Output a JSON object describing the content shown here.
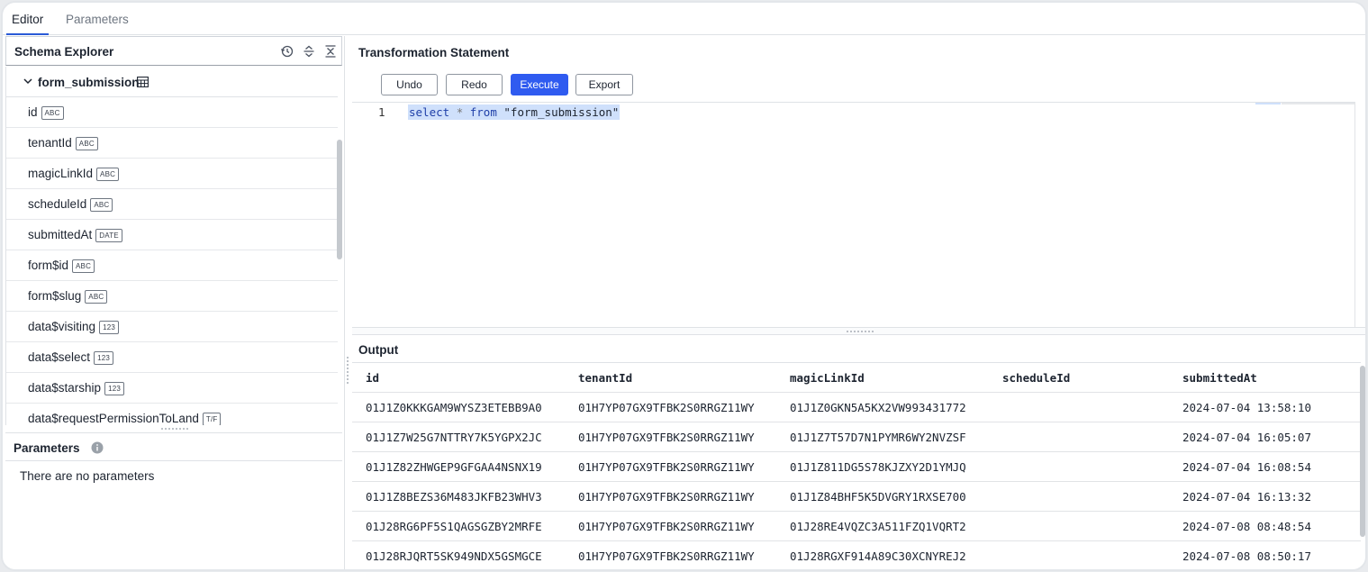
{
  "tabs": [
    {
      "label": "Editor",
      "active": true
    },
    {
      "label": "Parameters",
      "active": false
    }
  ],
  "schema_explorer": {
    "title": "Schema Explorer",
    "icons": [
      "history-icon",
      "expand-all-icon",
      "collapse-all-icon"
    ],
    "table": {
      "name": "form_submission",
      "icon": "table-icon"
    },
    "fields": [
      {
        "name": "id",
        "type": "ABC"
      },
      {
        "name": "tenantId",
        "type": "ABC"
      },
      {
        "name": "magicLinkId",
        "type": "ABC"
      },
      {
        "name": "scheduleId",
        "type": "ABC"
      },
      {
        "name": "submittedAt",
        "type": "DATE"
      },
      {
        "name": "form$id",
        "type": "ABC"
      },
      {
        "name": "form$slug",
        "type": "ABC"
      },
      {
        "name": "data$visiting",
        "type": "123"
      },
      {
        "name": "data$select",
        "type": "123"
      },
      {
        "name": "data$starship",
        "type": "123"
      },
      {
        "name": "data$requestPermissionToLand",
        "type": "T/F"
      }
    ]
  },
  "parameters": {
    "title": "Parameters",
    "empty_text": "There are no parameters"
  },
  "statement": {
    "title": "Transformation Statement",
    "buttons": {
      "undo": "Undo",
      "redo": "Redo",
      "execute": "Execute",
      "export": "Export"
    },
    "line_number": "1",
    "code": {
      "kw1": "select",
      "op": "*",
      "kw2": "from",
      "table": "\"form_submission\""
    }
  },
  "output": {
    "title": "Output",
    "columns": [
      "id",
      "tenantId",
      "magicLinkId",
      "scheduleId",
      "submittedAt"
    ],
    "rows": [
      [
        "01J1Z0KKKGAM9WYSZ3ETEBB9A0",
        "01H7YP07GX9TFBK2S0RRGZ11WY",
        "01J1Z0GKN5A5KX2VW993431772",
        "",
        "2024-07-04 13:58:10"
      ],
      [
        "01J1Z7W25G7NTTRY7K5YGPX2JC",
        "01H7YP07GX9TFBK2S0RRGZ11WY",
        "01J1Z7T57D7N1PYMR6WY2NVZSF",
        "",
        "2024-07-04 16:05:07"
      ],
      [
        "01J1Z82ZHWGEP9GFGAA4NSNX19",
        "01H7YP07GX9TFBK2S0RRGZ11WY",
        "01J1Z811DG5S78KJZXY2D1YMJQ",
        "",
        "2024-07-04 16:08:54"
      ],
      [
        "01J1Z8BEZS36M483JKFB23WHV3",
        "01H7YP07GX9TFBK2S0RRGZ11WY",
        "01J1Z84BHF5K5DVGRY1RXSE700",
        "",
        "2024-07-04 16:13:32"
      ],
      [
        "01J28RG6PF5S1QAGSGZBY2MRFE",
        "01H7YP07GX9TFBK2S0RRGZ11WY",
        "01J28RE4VQZC3A511FZQ1VQRT2",
        "",
        "2024-07-08 08:48:54"
      ],
      [
        "01J28RJQRT5SK949NDX5GSMGCE",
        "01H7YP07GX9TFBK2S0RRGZ11WY",
        "01J28RGXF914A89C30XCNYREJ2",
        "",
        "2024-07-08 08:50:17"
      ]
    ]
  }
}
